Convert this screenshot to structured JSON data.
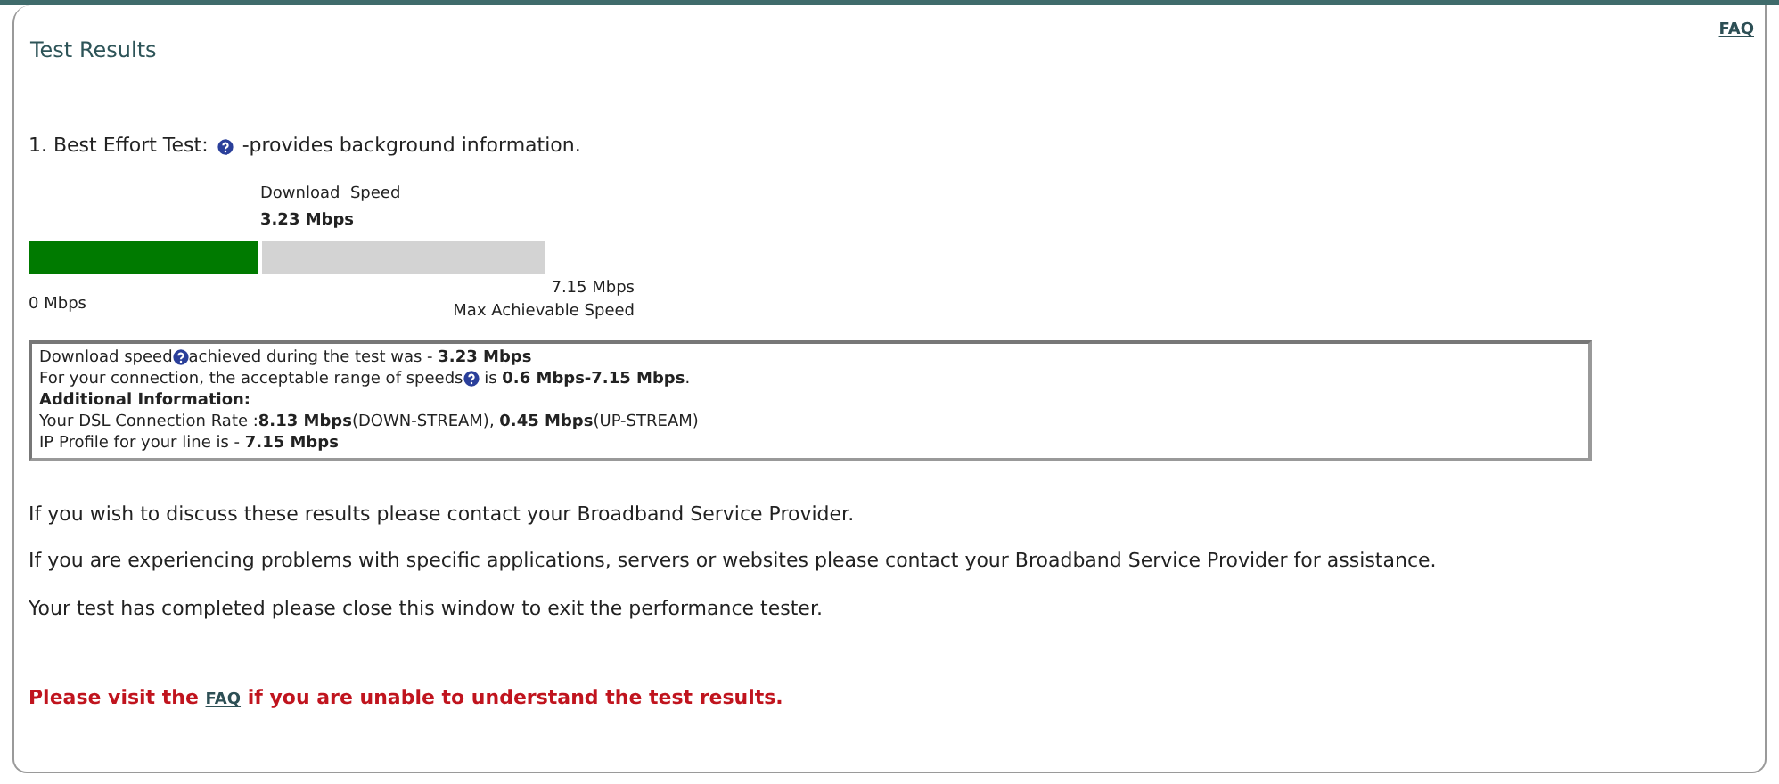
{
  "faq_link": "FAQ",
  "title": "Test Results",
  "test": {
    "number": "1.",
    "name": "Best Effort Test:",
    "description": "-provides background information."
  },
  "meter": {
    "caption": "Download  Speed",
    "value": "3.23 Mbps",
    "level": 0.45,
    "min_label": "0 Mbps",
    "max_label": "7.15 Mbps",
    "max_caption": "Max Achievable Speed"
  },
  "info_lines": [
    [
      {
        "kind": "text",
        "text": "Download speed"
      },
      {
        "kind": "help"
      },
      {
        "kind": "text",
        "text": "achieved during the test was - **3.23 Mbps**"
      }
    ],
    [
      {
        "kind": "text",
        "text": "For your connection, the acceptable range of speeds"
      },
      {
        "kind": "help"
      },
      {
        "kind": "text",
        "text": " is **0.6 Mbps-7.15 Mbps**."
      }
    ],
    [
      {
        "kind": "heading",
        "text": "Additional Information:"
      }
    ],
    [
      {
        "kind": "text",
        "text": "Your DSL Connection Rate :**8.13 Mbps**(DOWN-STREAM), **0.45 Mbps**(UP-STREAM)"
      }
    ],
    [
      {
        "kind": "text",
        "text": "IP Profile for your line is - **7.15 Mbps**"
      }
    ]
  ],
  "paragraphs": [
    "If you wish to discuss these results please contact your Broadband Service Provider.",
    "If you are experiencing problems with specific applications, servers or websites please contact your Broadband Service Provider for assistance.",
    "Your test has completed please close this window to exit the performance tester."
  ],
  "notice": {
    "before": "Please visit the",
    "link": "FAQ",
    "after": "if you are unable to understand the test results."
  }
}
